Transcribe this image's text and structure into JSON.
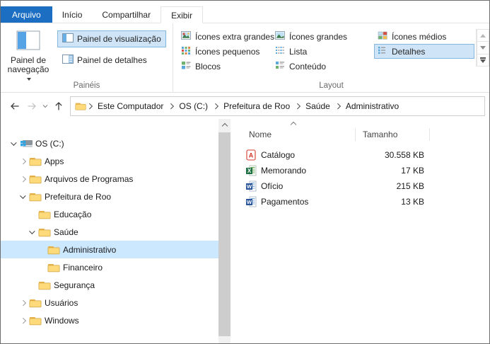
{
  "ribbon": {
    "tabs": [
      {
        "label": "Arquivo"
      },
      {
        "label": "Início"
      },
      {
        "label": "Compartilhar"
      },
      {
        "label": "Exibir"
      }
    ],
    "active_tab": "Exibir",
    "panels_group": {
      "group_label": "Painéis",
      "nav_button_label": "Painel de navegação",
      "nav_button_line1": "Painel de",
      "nav_button_line2": "navegação",
      "preview_pane_label": "Painel de visualização",
      "details_pane_label": "Painel de detalhes",
      "preview_pane_checked": true
    },
    "layout_group": {
      "group_label": "Layout",
      "selected_view": "Detalhes",
      "items": {
        "extra_large": "Ícones extra grandes",
        "large": "Ícones grandes",
        "medium": "Ícones médios",
        "small": "Ícones pequenos",
        "list": "Lista",
        "details": "Detalhes",
        "tiles": "Blocos",
        "content": "Conteúdo"
      }
    }
  },
  "address_bar": {
    "icons": {
      "back": "←",
      "forward": "→",
      "up": "↑"
    },
    "crumbs": [
      "Este Computador",
      "OS (C:)",
      "Prefeitura de Roo",
      "Saúde",
      "Administrativo"
    ]
  },
  "tree": {
    "items": [
      {
        "label": "OS (C:)",
        "level": 0,
        "state": "expanded",
        "icon": "drive",
        "selected": false
      },
      {
        "label": "Apps",
        "level": 1,
        "state": "collapsed",
        "icon": "folder",
        "selected": false
      },
      {
        "label": "Arquivos de Programas",
        "level": 1,
        "state": "collapsed",
        "icon": "folder",
        "selected": false
      },
      {
        "label": "Prefeitura de Roo",
        "level": 1,
        "state": "expanded",
        "icon": "folder",
        "selected": false
      },
      {
        "label": "Educação",
        "level": 2,
        "state": "none",
        "icon": "folder",
        "selected": false
      },
      {
        "label": "Saúde",
        "level": 2,
        "state": "expanded",
        "icon": "folder",
        "selected": false
      },
      {
        "label": "Administrativo",
        "level": 3,
        "state": "none",
        "icon": "folder",
        "selected": true
      },
      {
        "label": "Financeiro",
        "level": 3,
        "state": "none",
        "icon": "folder",
        "selected": false
      },
      {
        "label": "Segurança",
        "level": 2,
        "state": "none",
        "icon": "folder",
        "selected": false
      },
      {
        "label": "Usuários",
        "level": 1,
        "state": "collapsed",
        "icon": "folder",
        "selected": false
      },
      {
        "label": "Windows",
        "level": 1,
        "state": "collapsed",
        "icon": "folder",
        "selected": false
      }
    ]
  },
  "file_list": {
    "columns": {
      "name": "Nome",
      "size": "Tamanho"
    },
    "sort": {
      "column": "Nome",
      "direction": "ascending"
    },
    "files": [
      {
        "name": "Catálogo",
        "size": "30.558 KB",
        "type": "pdf"
      },
      {
        "name": "Memorando",
        "size": "17 KB",
        "type": "excel"
      },
      {
        "name": "Ofício",
        "size": "215 KB",
        "type": "word"
      },
      {
        "name": "Pagamentos",
        "size": "13 KB",
        "type": "word"
      }
    ]
  },
  "colors": {
    "file_tab_blue": "#1b6ec2",
    "tree_selection": "#cce8ff",
    "ribbon_checked_fill": "#cfe4f7",
    "ribbon_checked_border": "#84b7de",
    "folder_yellow": "#ffd977",
    "word_blue": "#2b579a",
    "excel_green": "#1e7145",
    "pdf_red": "#d33a2c"
  }
}
